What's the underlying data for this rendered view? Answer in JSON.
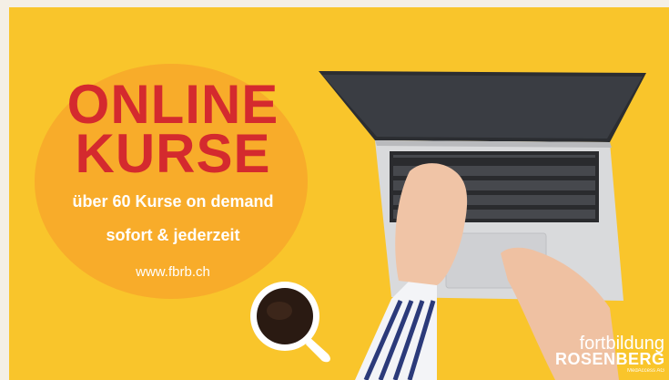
{
  "headline": {
    "line1": "ONLINE",
    "line2": "KURSE"
  },
  "subline1": "über 60 Kurse on demand",
  "subline2": "sofort & jederzeit",
  "url": "www.fbrb.ch",
  "brand": {
    "line1": "fortbildung",
    "line2": "ROSENBERG",
    "line3": "MedAccess AG"
  },
  "colors": {
    "background": "#f9c52b",
    "circle": "#f7a92a",
    "headline": "#d42a2e",
    "text": "#ffffff"
  },
  "illustration": [
    "laptop",
    "hands",
    "coffee-cup"
  ]
}
